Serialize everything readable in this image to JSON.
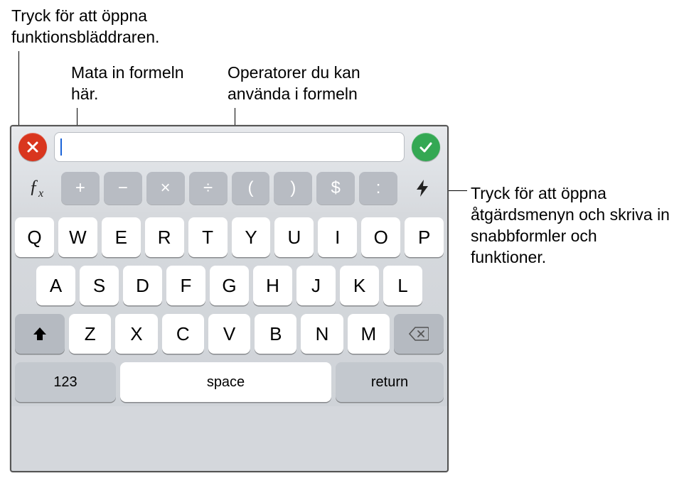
{
  "callouts": {
    "fx": "Tryck för att öppna funktionsbläddraren.",
    "formula": "Mata in formeln här.",
    "operators": "Operatorer du kan använda i formeln",
    "bolt": "Tryck för att öppna åtgärdsmenyn och skriva in snabbformler och funktioner."
  },
  "formula_bar": {
    "value": "",
    "placeholder": "",
    "cancel_icon": "close-icon",
    "accept_icon": "check-icon"
  },
  "fx_label": "ƒx",
  "operators": [
    "+",
    "−",
    "×",
    "÷",
    "(",
    ")",
    "$",
    ":"
  ],
  "keyboard": {
    "row1": [
      "Q",
      "W",
      "E",
      "R",
      "T",
      "Y",
      "U",
      "I",
      "O",
      "P"
    ],
    "row2": [
      "A",
      "S",
      "D",
      "F",
      "G",
      "H",
      "J",
      "K",
      "L"
    ],
    "row3": [
      "Z",
      "X",
      "C",
      "V",
      "B",
      "N",
      "M"
    ],
    "num_label": "123",
    "space_label": "space",
    "return_label": "return"
  }
}
